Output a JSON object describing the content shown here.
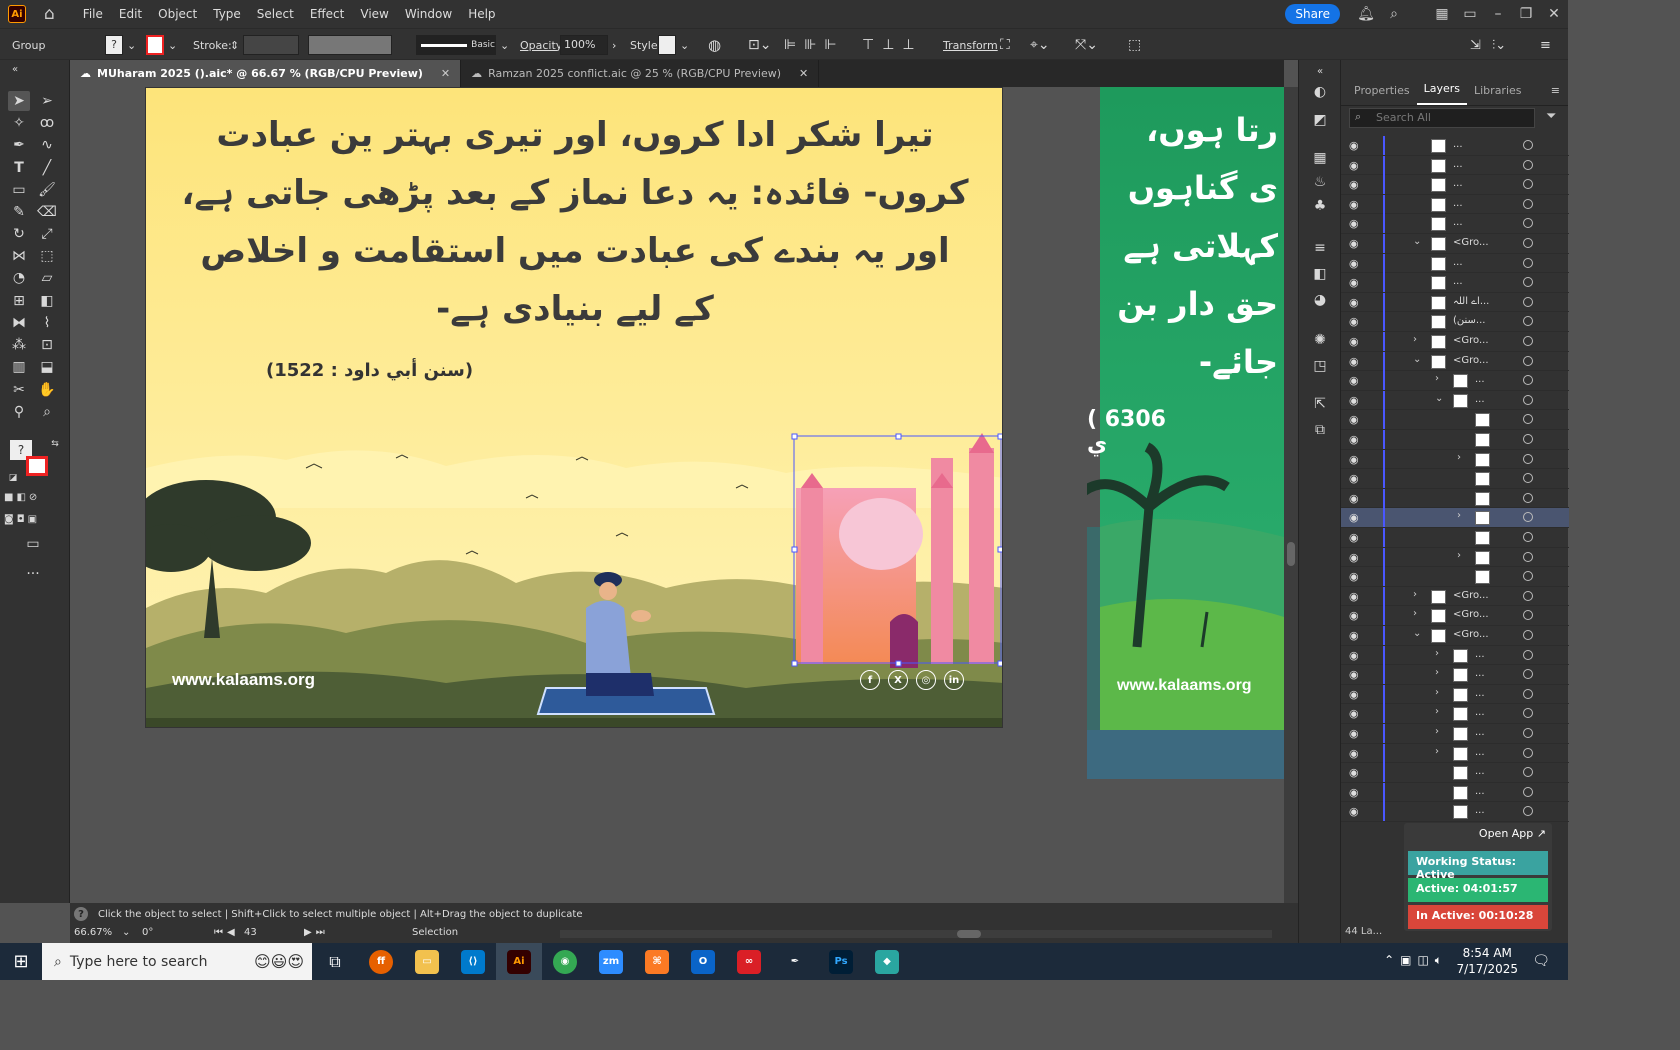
{
  "menubar": {
    "items": [
      "File",
      "Edit",
      "Object",
      "Type",
      "Select",
      "Effect",
      "View",
      "Window",
      "Help"
    ],
    "share_label": "Share"
  },
  "controlbar": {
    "selection_type": "Group",
    "stroke_label": "Stroke:",
    "stroke_profile": "Basic",
    "opacity_label": "Opacity:",
    "opacity_value": "100%",
    "style_label": "Style:",
    "transform_label": "Transform"
  },
  "tabs": [
    {
      "label": "MUharam 2025 ().aic* @ 66.67 % (RGB/CPU Preview)",
      "active": true
    },
    {
      "label": "Ramzan 2025 conflict.aic @ 25 % (RGB/CPU Preview)",
      "active": false
    }
  ],
  "artboard1": {
    "urdu_lines": [
      "تیرا شکر ادا کروں، اور تیری بہتر ین عبادت",
      "کروں- فائدہ: یہ دعا نماز کے بعد پڑھی جاتی ہے،",
      "اور یہ بندے کی عبادت میں استقامت و اخلاص",
      "کے لیے بنیادی ہے-"
    ],
    "reference": "(سنن أبي داود : 1522)",
    "website": "www.kalaams.org",
    "social_icons": [
      "facebook-icon",
      "x-icon",
      "instagram-icon",
      "linkedin-icon"
    ],
    "social_glyphs": [
      "f",
      "X",
      "◎",
      "in"
    ]
  },
  "artboard2": {
    "urdu_lines": [
      "رتا ہوں،",
      "ی گناہوں",
      "کہلاتی ہے",
      "حق دار بن",
      "جائے-"
    ],
    "reference": "( 6306 ي",
    "website": "www.kalaams.org"
  },
  "statusbar": {
    "hint": "Click the object to select  |  Shift+Click to select multiple object  |  Alt+Drag the object to duplicate",
    "zoom": "66.67%",
    "rotation": "0°",
    "artboard_number": "43",
    "tool": "Selection"
  },
  "panel": {
    "tabs": [
      "Properties",
      "Layers",
      "Libraries"
    ],
    "active_tab": "Layers",
    "search_placeholder": "Search All",
    "layer_count": "44 La...",
    "layers": [
      {
        "name": "...",
        "indent": 2,
        "expand": ""
      },
      {
        "name": "...",
        "indent": 2,
        "expand": ""
      },
      {
        "name": "...",
        "indent": 2,
        "expand": ""
      },
      {
        "name": "...",
        "indent": 2,
        "expand": ""
      },
      {
        "name": "...",
        "indent": 2,
        "expand": ""
      },
      {
        "name": "<Gro...",
        "indent": 2,
        "expand": "⌄"
      },
      {
        "name": "...",
        "indent": 2,
        "expand": ""
      },
      {
        "name": "...",
        "indent": 2,
        "expand": ""
      },
      {
        "name": "اے اللہ...",
        "indent": 2,
        "expand": ""
      },
      {
        "name": "(سنن...",
        "indent": 2,
        "expand": ""
      },
      {
        "name": "<Gro...",
        "indent": 2,
        "expand": "›"
      },
      {
        "name": "<Gro...",
        "indent": 2,
        "expand": "⌄"
      },
      {
        "name": "...",
        "indent": 3,
        "expand": "›"
      },
      {
        "name": "...",
        "indent": 3,
        "expand": "⌄"
      },
      {
        "name": "",
        "indent": 4,
        "expand": ""
      },
      {
        "name": "",
        "indent": 4,
        "expand": ""
      },
      {
        "name": "",
        "indent": 4,
        "expand": "›"
      },
      {
        "name": "",
        "indent": 4,
        "expand": ""
      },
      {
        "name": "",
        "indent": 4,
        "expand": ""
      },
      {
        "name": "",
        "indent": 4,
        "expand": "›",
        "selected": true
      },
      {
        "name": "",
        "indent": 4,
        "expand": ""
      },
      {
        "name": "",
        "indent": 4,
        "expand": "›"
      },
      {
        "name": "",
        "indent": 4,
        "expand": ""
      },
      {
        "name": "<Gro...",
        "indent": 2,
        "expand": "›"
      },
      {
        "name": "<Gro...",
        "indent": 2,
        "expand": "›"
      },
      {
        "name": "<Gro...",
        "indent": 2,
        "expand": "⌄"
      },
      {
        "name": "...",
        "indent": 3,
        "expand": "›"
      },
      {
        "name": "...",
        "indent": 3,
        "expand": "›"
      },
      {
        "name": "...",
        "indent": 3,
        "expand": "›"
      },
      {
        "name": "...",
        "indent": 3,
        "expand": "›"
      },
      {
        "name": "...",
        "indent": 3,
        "expand": "›"
      },
      {
        "name": "...",
        "indent": 3,
        "expand": "›"
      },
      {
        "name": "...",
        "indent": 3,
        "expand": ""
      },
      {
        "name": "...",
        "indent": 3,
        "expand": ""
      },
      {
        "name": "...",
        "indent": 3,
        "expand": ""
      }
    ]
  },
  "widget": {
    "open_app": "Open App ↗",
    "working_status": "Working Status: Active",
    "active_time": "Active: 04:01:57",
    "inactive_time": "In Active: 00:10:28"
  },
  "taskbar": {
    "search_placeholder": "Type here to search",
    "time": "8:54 AM",
    "date": "7/17/2025",
    "apps": [
      "task-view",
      "firefox",
      "file-explorer",
      "vscode",
      "illustrator",
      "chrome",
      "zoom",
      "xampp",
      "outlook",
      "creative-cloud",
      "pen-tool",
      "photoshop",
      "app"
    ]
  },
  "colors": {
    "accent_blue": "#1473e6",
    "selection_blue": "#4a57ff",
    "artboard1_bg": "#fde98a",
    "artboard2_bg": "#1e9a5c",
    "widget_teal": "#3aa3a0",
    "widget_green": "#2bb673",
    "widget_red": "#d9463a"
  }
}
